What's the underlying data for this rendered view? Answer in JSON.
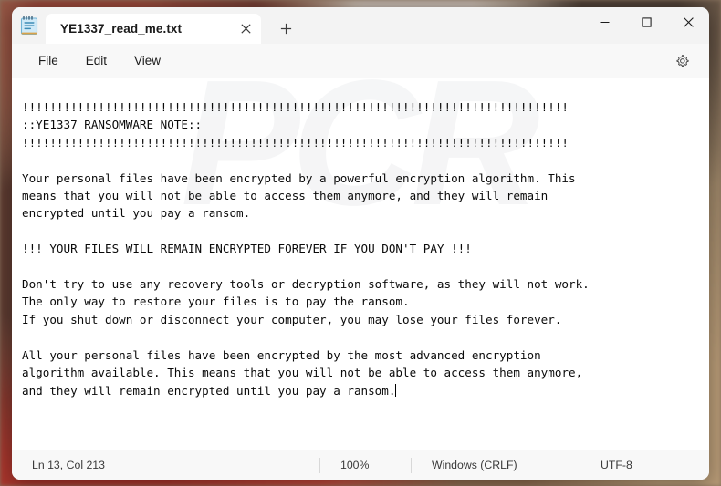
{
  "window": {
    "app_icon": "notepad-icon",
    "tab_label": "YE1337_read_me.txt",
    "tab_close_icon": "close-icon",
    "new_tab_icon": "plus-icon",
    "minimize_icon": "minimize-icon",
    "maximize_icon": "maximize-icon",
    "close_icon": "close-icon"
  },
  "menubar": {
    "items": [
      {
        "label": "File"
      },
      {
        "label": "Edit"
      },
      {
        "label": "View"
      }
    ],
    "settings_icon": "gear-icon"
  },
  "editor": {
    "watermark": "PCR",
    "content": "!!!!!!!!!!!!!!!!!!!!!!!!!!!!!!!!!!!!!!!!!!!!!!!!!!!!!!!!!!!!!!!!!!!!!!!!!!!!!!!\n::YE1337 RANSOMWARE NOTE::\n!!!!!!!!!!!!!!!!!!!!!!!!!!!!!!!!!!!!!!!!!!!!!!!!!!!!!!!!!!!!!!!!!!!!!!!!!!!!!!!\n\nYour personal files have been encrypted by a powerful encryption algorithm. This\nmeans that you will not be able to access them anymore, and they will remain\nencrypted until you pay a ransom.\n\n!!! YOUR FILES WILL REMAIN ENCRYPTED FOREVER IF YOU DON'T PAY !!!\n\nDon't try to use any recovery tools or decryption software, as they will not work.\nThe only way to restore your files is to pay the ransom.\nIf you shut down or disconnect your computer, you may lose your files forever.\n\nAll your personal files have been encrypted by the most advanced encryption\nalgorithm available. This means that you will not be able to access them anymore,\nand they will remain encrypted until you pay a ransom."
  },
  "statusbar": {
    "line_col": "Ln 13, Col 213",
    "zoom": "100%",
    "line_ending": "Windows (CRLF)",
    "encoding": "UTF-8"
  },
  "colors": {
    "window_bg": "#f3f3f3",
    "editor_bg": "#ffffff",
    "text": "#0a0a0a",
    "accent_close_hover": "#c42b1c"
  }
}
